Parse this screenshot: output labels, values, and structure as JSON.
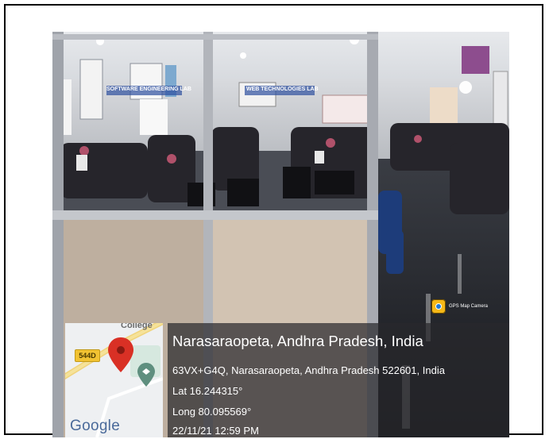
{
  "photo": {
    "signs": [
      "SOFTWARE ENGINEERING LAB",
      "WEB TECHNOLOGIES LAB"
    ]
  },
  "overlay": {
    "camera_app_label": "GPS Map Camera",
    "location_title": "Narasaraopeta, Andhra Pradesh, India",
    "address": "63VX+G4Q, Narasaraopeta, Andhra Pradesh 522601, India",
    "latitude": "Lat 16.244315°",
    "longitude": "Long 80.095569°",
    "timestamp": "22/11/21 12:59 PM"
  },
  "map": {
    "road_badge": "544D",
    "road_label": "College",
    "provider_label": "Google",
    "pin_color": "#d93025",
    "poi_color": "#5f8f7f"
  }
}
